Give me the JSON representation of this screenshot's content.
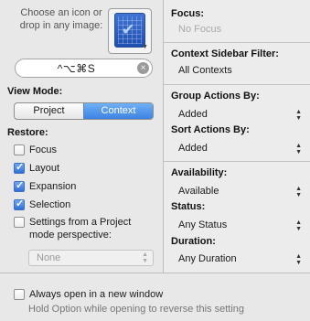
{
  "icon_area": {
    "hint": "Choose an icon or drop in any image:"
  },
  "shortcut": {
    "value": "^⌥⌘S"
  },
  "view_mode": {
    "label": "View Mode:",
    "options": [
      "Project",
      "Context"
    ],
    "selected": "Context"
  },
  "restore": {
    "label": "Restore:",
    "items": [
      {
        "label": "Focus",
        "checked": false
      },
      {
        "label": "Layout",
        "checked": true
      },
      {
        "label": "Expansion",
        "checked": true
      },
      {
        "label": "Selection",
        "checked": true
      },
      {
        "label": "Settings from a Project mode perspective:",
        "checked": false
      }
    ],
    "perspective_value": "None"
  },
  "focus": {
    "label": "Focus:",
    "value": "No Focus"
  },
  "context_filter": {
    "label": "Context Sidebar Filter:",
    "value": "All Contexts"
  },
  "group_actions": {
    "label": "Group Actions By:",
    "value": "Added"
  },
  "sort_actions": {
    "label": "Sort Actions By:",
    "value": "Added"
  },
  "availability": {
    "label": "Availability:",
    "value": "Available"
  },
  "status": {
    "label": "Status:",
    "value": "Any Status"
  },
  "duration": {
    "label": "Duration:",
    "value": "Any Duration"
  },
  "always_open": {
    "label": "Always open in a new window",
    "checked": false,
    "hint": "Hold Option while opening to reverse this setting"
  },
  "icons": {
    "clear": "clear-icon",
    "popup": "up-down-arrows-icon"
  },
  "colors": {
    "accent": "#3c82e2",
    "icon_blue": "#1e4fb0"
  }
}
